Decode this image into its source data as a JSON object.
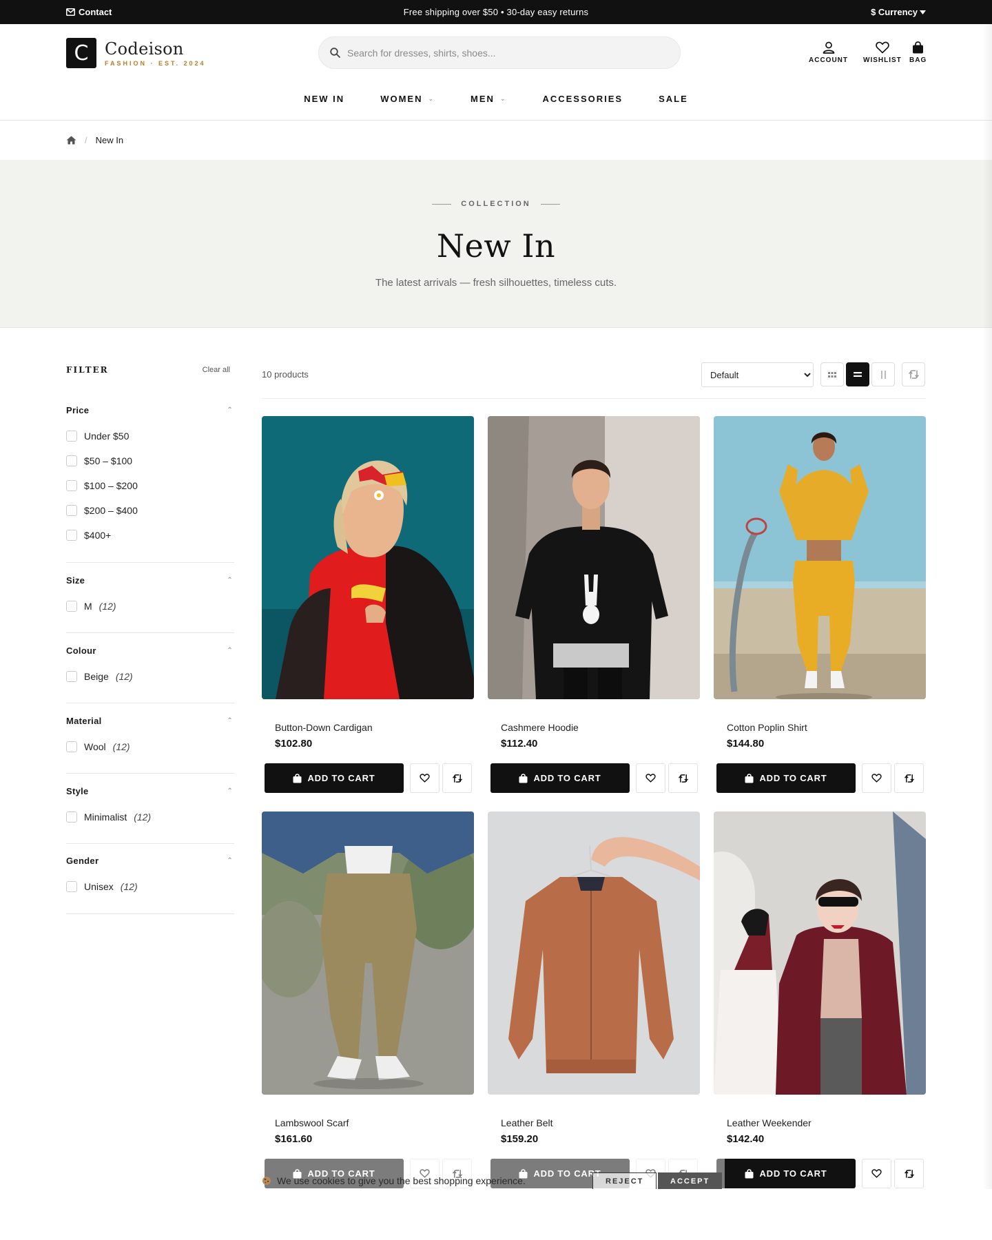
{
  "topbar": {
    "contact": "Contact",
    "promo": "Free shipping over $50 • 30-day easy returns",
    "currency": "$ Currency"
  },
  "brand": {
    "name": "Codeison",
    "tagline": "FASHION · EST. 2024",
    "mark": "C"
  },
  "search": {
    "placeholder": "Search for dresses, shirts, shoes..."
  },
  "header_actions": {
    "account": "ACCOUNT",
    "wishlist": "WISHLIST",
    "bag": "BAG"
  },
  "nav": [
    {
      "label": "NEW IN",
      "dropdown": false
    },
    {
      "label": "WOMEN",
      "dropdown": true
    },
    {
      "label": "MEN",
      "dropdown": true
    },
    {
      "label": "ACCESSORIES",
      "dropdown": false
    },
    {
      "label": "SALE",
      "dropdown": false
    }
  ],
  "breadcrumb": {
    "current": "New In"
  },
  "hero": {
    "eyebrow": "COLLECTION",
    "title": "New In",
    "subtitle": "The latest arrivals — fresh silhouettes, timeless cuts."
  },
  "filters": {
    "title": "FILTER",
    "clear": "Clear all",
    "groups": [
      {
        "name": "Price",
        "options": [
          {
            "label": "Under $50",
            "count": ""
          },
          {
            "label": "$50 – $100",
            "count": ""
          },
          {
            "label": "$100 – $200",
            "count": ""
          },
          {
            "label": "$200 – $400",
            "count": ""
          },
          {
            "label": "$400+",
            "count": ""
          }
        ]
      },
      {
        "name": "Size",
        "options": [
          {
            "label": "M",
            "count": "(12)"
          }
        ]
      },
      {
        "name": "Colour",
        "options": [
          {
            "label": "Beige",
            "count": "(12)"
          }
        ]
      },
      {
        "name": "Material",
        "options": [
          {
            "label": "Wool",
            "count": "(12)"
          }
        ]
      },
      {
        "name": "Style",
        "options": [
          {
            "label": "Minimalist",
            "count": "(12)"
          }
        ]
      },
      {
        "name": "Gender",
        "options": [
          {
            "label": "Unisex",
            "count": "(12)"
          }
        ]
      }
    ]
  },
  "toolbar": {
    "count": "10 products",
    "sort_options": [
      "Default"
    ],
    "sort_selected": "Default",
    "view_active": "list"
  },
  "products": [
    {
      "name": "Button-Down Cardigan",
      "price": "$102.80",
      "cta": "ADD TO CART"
    },
    {
      "name": "Cashmere Hoodie",
      "price": "$112.40",
      "cta": "ADD TO CART"
    },
    {
      "name": "Cotton Poplin Shirt",
      "price": "$144.80",
      "cta": "ADD TO CART"
    },
    {
      "name": "Lambswool Scarf",
      "price": "$161.60",
      "cta": "ADD TO CART"
    },
    {
      "name": "Leather Belt",
      "price": "$159.20",
      "cta": "ADD TO CART"
    },
    {
      "name": "Leather Weekender",
      "price": "$142.40",
      "cta": "ADD TO CART"
    }
  ],
  "cookie": {
    "message": "We use cookies to give you the best shopping experience.",
    "reject": "REJECT",
    "accept": "ACCEPT"
  },
  "colors": {
    "accent": "#c07a1e",
    "dark": "#111111",
    "hero_bg": "#f2f2ee"
  },
  "icons": [
    "mail-icon",
    "caret-down-icon",
    "search-icon",
    "user-icon",
    "heart-icon",
    "bag-icon",
    "home-icon",
    "chevron-up-icon",
    "grid-icon",
    "list-icon",
    "columns-icon",
    "compare-icon",
    "cookie-icon"
  ]
}
